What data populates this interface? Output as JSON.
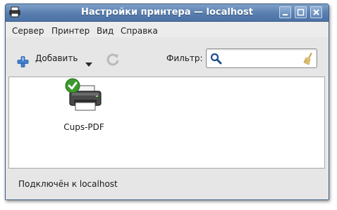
{
  "window": {
    "title": "Настройки принтера — localhost"
  },
  "menubar": {
    "items": [
      "Сервер",
      "Принтер",
      "Вид",
      "Справка"
    ]
  },
  "toolbar": {
    "add_label": "Добавить",
    "filter_label": "Фильтр:",
    "filter_value": ""
  },
  "printers": [
    {
      "name": "Cups-PDF",
      "status": "default"
    }
  ],
  "statusbar": {
    "text": "Подключён к localhost"
  },
  "colors": {
    "titlebar": "#587eaf",
    "accent_blue": "#2f6fc0",
    "check_green": "#3c9a2c"
  }
}
